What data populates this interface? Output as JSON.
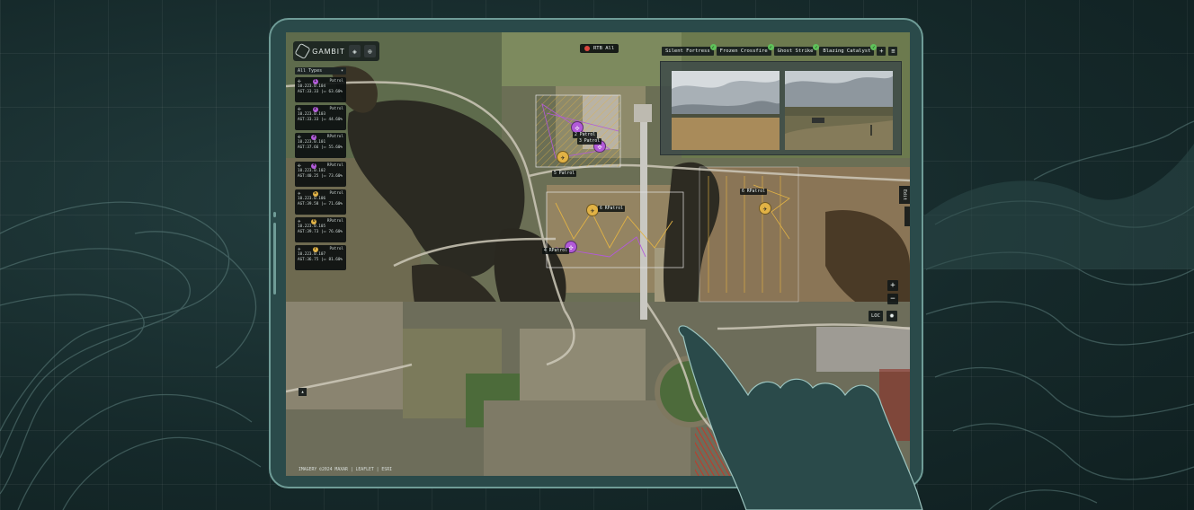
{
  "app": {
    "logo_text": "GAMBIT"
  },
  "toolbar": {
    "layers_icon": "layers-icon",
    "globe_icon": "globe-icon"
  },
  "asset_filter": {
    "selected": "All Types"
  },
  "assets": [
    {
      "type": "drone",
      "number": "1",
      "mode": "Patrol",
      "color": "#b25ad8",
      "ip": "10.223.0.104",
      "alt": "AGT:33.33",
      "battery": "63.60%"
    },
    {
      "type": "drone",
      "number": "2",
      "mode": "Patrol",
      "color": "#b25ad8",
      "ip": "10.223.0.103",
      "alt": "AGT:33.33",
      "battery": "44.60%"
    },
    {
      "type": "drone",
      "number": "3",
      "mode": "RPatrol",
      "color": "#b25ad8",
      "ip": "10.223.0.101",
      "alt": "AGT:37.66",
      "battery": "55.60%"
    },
    {
      "type": "drone",
      "number": "4",
      "mode": "RPatrol",
      "color": "#b25ad8",
      "ip": "10.223.0.102",
      "alt": "AGT:40.25",
      "battery": "73.60%"
    },
    {
      "type": "plane",
      "number": "5",
      "mode": "Patrol",
      "color": "#e1b245",
      "ip": "10.223.0.106",
      "alt": "AGT:39.58",
      "battery": "71.60%"
    },
    {
      "type": "plane",
      "number": "6",
      "mode": "RPatrol",
      "color": "#e1b245",
      "ip": "10.223.0.105",
      "alt": "AGT:39.73",
      "battery": "76.60%"
    },
    {
      "type": "plane",
      "number": "7",
      "mode": "Patrol",
      "color": "#e1b245",
      "ip": "10.223.0.107",
      "alt": "AGT:36.75",
      "battery": "81.60%"
    }
  ],
  "map": {
    "rtb_all": "RTB All",
    "labels": {
      "patrol_a": "2 Patrol",
      "patrol_a2": "3 Patrol",
      "patrol_b": "5 Patrol",
      "patrol_c": "6 RPatrol",
      "patrol_d": "4 RPatrol",
      "patrol_e": "6 RPatrol"
    },
    "loc_button": "LOC",
    "zoom_in": "+",
    "zoom_out": "−",
    "edge_tab": "Edit",
    "attribution": "IMAGERY ©2024 MAXAR | LEAFLET | ESRI"
  },
  "cameras": {
    "tabs": [
      "Silent Fortress",
      "Frozen Crossfire",
      "Ghost Strike",
      "Blazing Catalyst"
    ],
    "plus": "+",
    "menu": "≡"
  },
  "colors": {
    "accent": "#6f9c97",
    "drone": "#b25ad8",
    "plane": "#e1b245",
    "ok": "#5fc25a",
    "alert": "#d9473f"
  }
}
